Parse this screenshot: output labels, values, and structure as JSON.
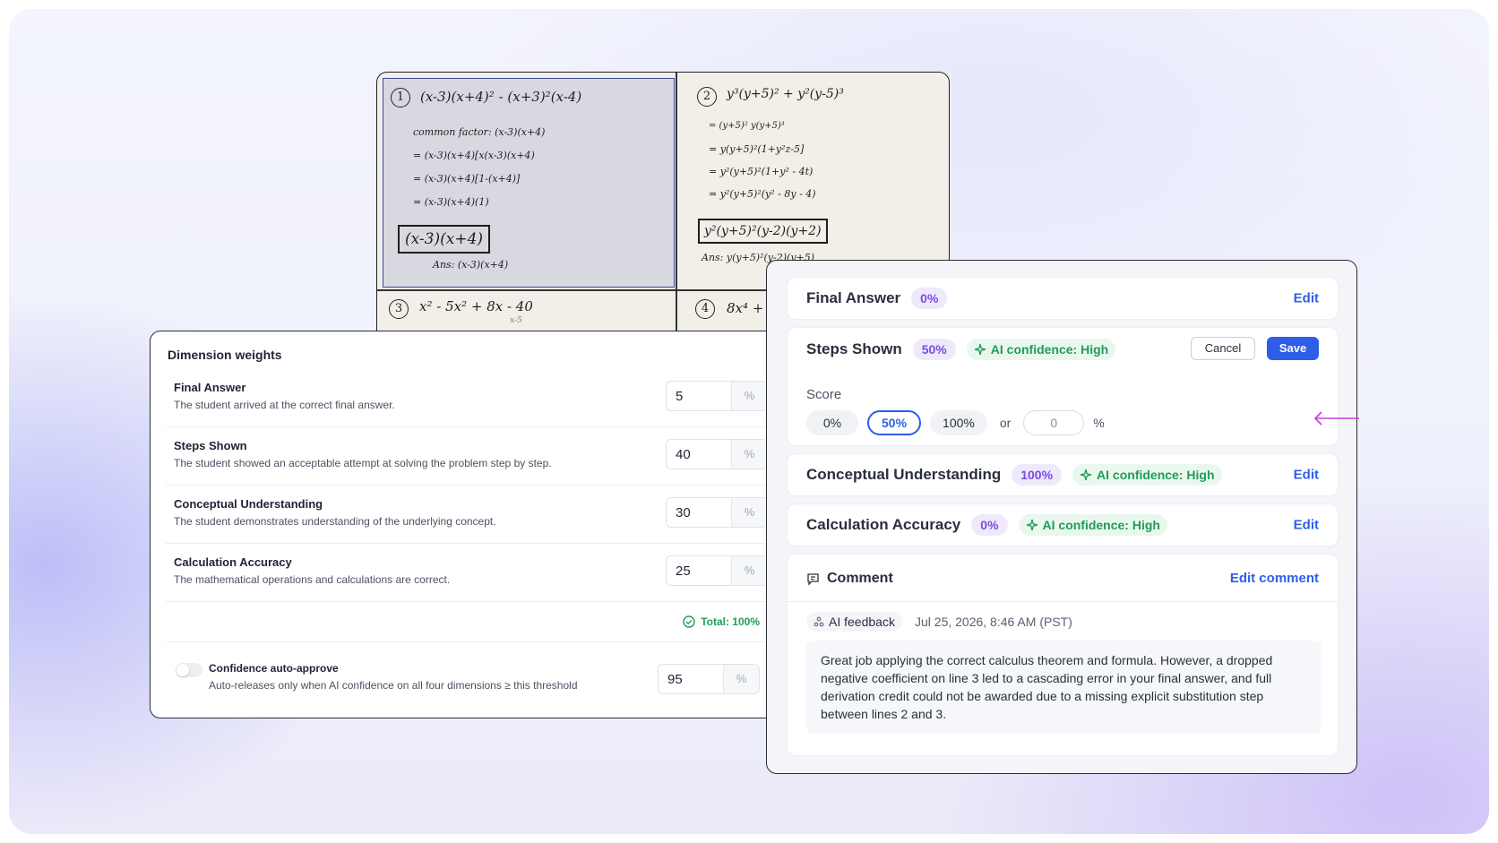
{
  "worksheet": {
    "q1": {
      "num": "1",
      "problem": "(x-3)(x+4)² - (x+3)²(x-4)",
      "steps": [
        "common factor: (x-3)(x+4)",
        "= (x-3)(x+4)[x(x-3)(x+4)",
        "= (x-3)(x+4)[1-(x+4)]",
        "= (x-3)(x+4)(1)"
      ],
      "boxed": "(x-3)(x+4)",
      "answer": "Ans: (x-3)(x+4)"
    },
    "q2": {
      "num": "2",
      "problem": "y³(y+5)² + y²(y-5)³",
      "steps": [
        "= (y+5)² y(y+5)³",
        "= y(y+5)²(1+y²z-5]",
        "= y²(y+5)²(1+y² - 4t)",
        "= y²(y+5)²(y² - 8y - 4)"
      ],
      "boxed": "y²(y+5)²(y-2)(y+2)",
      "answer": "Ans: y(y+5)²(y-2)(y+5)"
    },
    "q3": {
      "num": "3",
      "problem": "x² - 5x² + 8x - 40",
      "sub": "x-5"
    },
    "q4": {
      "num": "4",
      "problem": "8x⁴ +"
    }
  },
  "weights": {
    "title": "Dimension weights",
    "unit": "%",
    "rows": [
      {
        "name": "Final Answer",
        "desc": "The student arrived at the correct final answer.",
        "value": "5"
      },
      {
        "name": "Steps Shown",
        "desc": "The student showed an acceptable attempt at solving the problem step by step.",
        "value": "40"
      },
      {
        "name": "Conceptual Understanding",
        "desc": "The student demonstrates understanding of the underlying concept.",
        "value": "30"
      },
      {
        "name": "Calculation Accuracy",
        "desc": "The mathematical operations and calculations are correct.",
        "value": "25"
      }
    ],
    "total": "Total: 100%",
    "auto_approve": {
      "name": "Confidence auto-approve",
      "desc": "Auto-releases only when AI confidence on all four dimensions ≥ this threshold",
      "value": "95",
      "enabled": false
    }
  },
  "grading": {
    "final_answer": {
      "name": "Final Answer",
      "pct": "0%",
      "edit": "Edit"
    },
    "steps_shown": {
      "name": "Steps Shown",
      "pct": "50%",
      "confidence": "AI confidence: High",
      "cancel": "Cancel",
      "save": "Save",
      "score_label": "Score",
      "options": [
        "0%",
        "50%",
        "100%"
      ],
      "selected": "50%",
      "or": "or",
      "custom_placeholder": "0",
      "custom_unit": "%"
    },
    "conceptual": {
      "name": "Conceptual Understanding",
      "pct": "100%",
      "confidence": "AI confidence: High",
      "edit": "Edit"
    },
    "calculation": {
      "name": "Calculation Accuracy",
      "pct": "0%",
      "confidence": "AI confidence: High",
      "edit": "Edit"
    },
    "comment": {
      "title": "Comment",
      "edit": "Edit comment",
      "ai_label": "AI feedback",
      "date": "Jul 25, 2026, 8:46 AM (PST)",
      "text": "Great job applying the correct calculus theorem and formula. However, a dropped negative coefficient on line 3 led to a cascading error in your final answer, and full derivation credit could not be awarded due to a missing explicit substitution step between lines 2 and 3."
    }
  },
  "colors": {
    "accent": "#2e5ee8",
    "purple": "#7a4be0",
    "green": "#1f9d57"
  }
}
